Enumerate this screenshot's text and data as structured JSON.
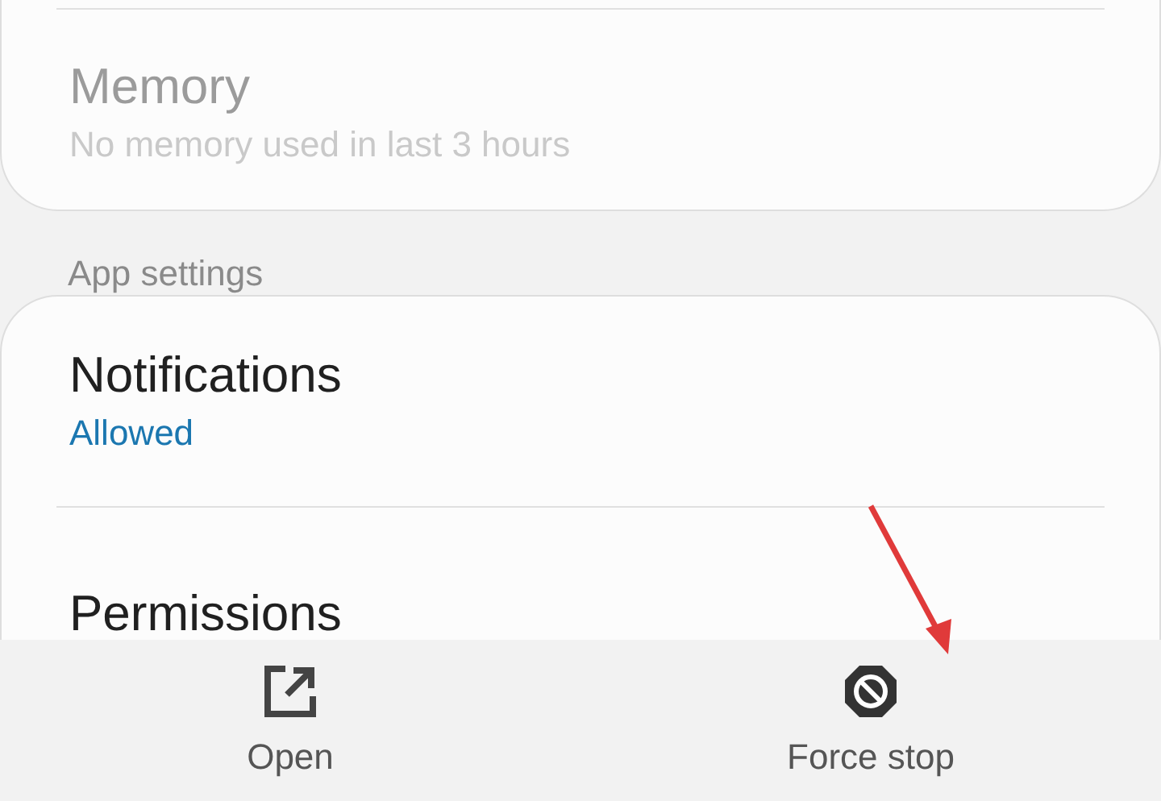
{
  "usage_card": {
    "items": [
      {
        "title": "Memory",
        "subtitle": "No memory used in last 3 hours",
        "disabled": true
      }
    ]
  },
  "section_header": "App settings",
  "settings_card": {
    "items": [
      {
        "title": "Notifications",
        "subtitle": "Allowed"
      },
      {
        "title": "Permissions"
      }
    ]
  },
  "bottom_bar": {
    "actions": [
      {
        "kind": "open",
        "label": "Open"
      },
      {
        "kind": "force-stop",
        "label": "Force stop"
      }
    ]
  },
  "annotation": {
    "kind": "arrow"
  }
}
